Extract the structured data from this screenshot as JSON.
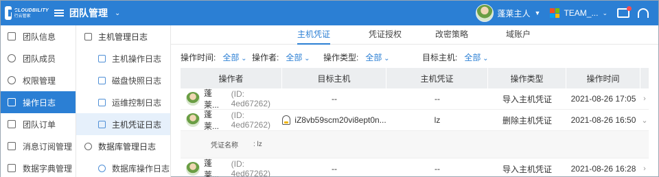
{
  "brand": {
    "name": "CLOUDBILITY",
    "subtitle": "行云管家"
  },
  "header": {
    "title": "团队管理",
    "user": "蓬莱主人",
    "team": "TEAM_..."
  },
  "colors": {
    "primary": "#2b7fd4",
    "ms_red": "#f25022",
    "ms_green": "#7fba00",
    "ms_blue": "#00a4ef",
    "ms_yellow": "#ffb900"
  },
  "sidebar": {
    "items": [
      {
        "label": "团队信息",
        "icon": "info-icon"
      },
      {
        "label": "团队成员",
        "icon": "members-icon"
      },
      {
        "label": "权限管理",
        "icon": "permission-icon"
      },
      {
        "label": "操作日志",
        "icon": "log-icon",
        "active": true
      },
      {
        "label": "团队订单",
        "icon": "order-icon"
      },
      {
        "label": "消息订阅管理",
        "icon": "mail-icon"
      },
      {
        "label": "数据字典管理",
        "icon": "dictionary-icon"
      }
    ]
  },
  "subnav": {
    "group1": "主机管理日志",
    "items1": [
      "主机操作日志",
      "磁盘快照日志",
      "运维控制日志",
      "主机凭证日志"
    ],
    "group2": "数据库管理日志",
    "items2": [
      "数据库操作日志"
    ]
  },
  "tabs": [
    "主机凭证",
    "凭证授权",
    "改密策略",
    "域账户"
  ],
  "filters": {
    "time_label": "操作时间:",
    "time_value": "全部",
    "op_label": "操作者:",
    "op_value": "全部",
    "type_label": "操作类型:",
    "type_value": "全部",
    "host_label": "目标主机:",
    "host_value": "全部"
  },
  "table": {
    "headers": [
      "操作者",
      "目标主机",
      "主机凭证",
      "操作类型",
      "操作时间"
    ],
    "rows": [
      {
        "operator": "蓬莱...",
        "id": "(ID: 4ed67262)",
        "host": "--",
        "cred": "--",
        "type": "导入主机凭证",
        "time": "2021-08-26 17:05",
        "arrow": "›"
      },
      {
        "operator": "蓬莱...",
        "id": "(ID: 4ed67262)",
        "host": "iZ8vb59scm20vi8ept0n...",
        "cred": "lz",
        "type": "删除主机凭证",
        "time": "2021-08-26 16:50",
        "arrow": "⌄"
      },
      {
        "operator": "蓬莱...",
        "id": "(ID: 4ed67262)",
        "host": "--",
        "cred": "--",
        "type": "导入主机凭证",
        "time": "2021-08-26 16:28",
        "arrow": "›"
      }
    ],
    "detail_label": "凭证名称",
    "detail_value": ": lz"
  }
}
